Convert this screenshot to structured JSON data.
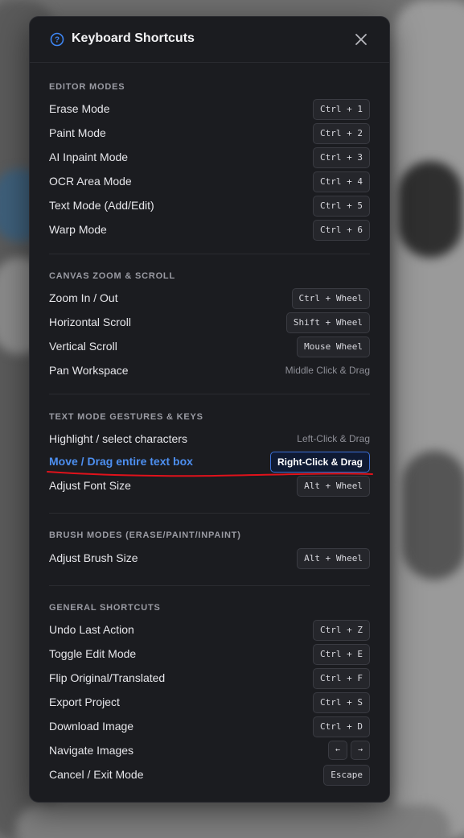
{
  "header": {
    "title": "Keyboard Shortcuts"
  },
  "sections": [
    {
      "title": "EDITOR MODES",
      "rows": [
        {
          "label": "Erase Mode",
          "keys": "Ctrl + 1"
        },
        {
          "label": "Paint Mode",
          "keys": "Ctrl + 2"
        },
        {
          "label": "AI Inpaint Mode",
          "keys": "Ctrl + 3"
        },
        {
          "label": "OCR Area Mode",
          "keys": "Ctrl + 4"
        },
        {
          "label": "Text Mode (Add/Edit)",
          "keys": "Ctrl + 5"
        },
        {
          "label": "Warp Mode",
          "keys": "Ctrl + 6"
        }
      ]
    },
    {
      "title": "CANVAS ZOOM & SCROLL",
      "rows": [
        {
          "label": "Zoom In / Out",
          "keys": "Ctrl + Wheel"
        },
        {
          "label": "Horizontal Scroll",
          "keys": "Shift + Wheel"
        },
        {
          "label": "Vertical Scroll",
          "keys": "Mouse Wheel"
        },
        {
          "label": "Pan Workspace",
          "keys": "Middle Click & Drag"
        }
      ]
    },
    {
      "title": "TEXT MODE GESTURES & KEYS",
      "rows": [
        {
          "label": "Highlight / select characters",
          "keys": "Left-Click & Drag"
        },
        {
          "label": "Move / Drag entire text box",
          "keys": "Right-Click & Drag"
        },
        {
          "label": "Adjust Font Size",
          "keys": "Alt + Wheel"
        }
      ]
    },
    {
      "title": "BRUSH MODES (ERASE/PAINT/INPAINT)",
      "rows": [
        {
          "label": "Adjust Brush Size",
          "keys": "Alt + Wheel"
        }
      ]
    },
    {
      "title": "GENERAL SHORTCUTS",
      "rows": [
        {
          "label": "Undo Last Action",
          "keys": "Ctrl + Z"
        },
        {
          "label": "Toggle Edit Mode",
          "keys": "Ctrl + E"
        },
        {
          "label": "Flip Original/Translated",
          "keys": "Ctrl + F"
        },
        {
          "label": "Export Project",
          "keys": "Ctrl + S"
        },
        {
          "label": "Download Image",
          "keys": "Ctrl + D"
        },
        {
          "label": "Navigate Images",
          "keys": [
            "←",
            "→"
          ]
        },
        {
          "label": "Cancel / Exit Mode",
          "keys": "Escape"
        }
      ]
    }
  ],
  "colors": {
    "modal_bg": "#1b1c20",
    "accent": "#4d8ff0",
    "annotation": "#e0121b"
  }
}
